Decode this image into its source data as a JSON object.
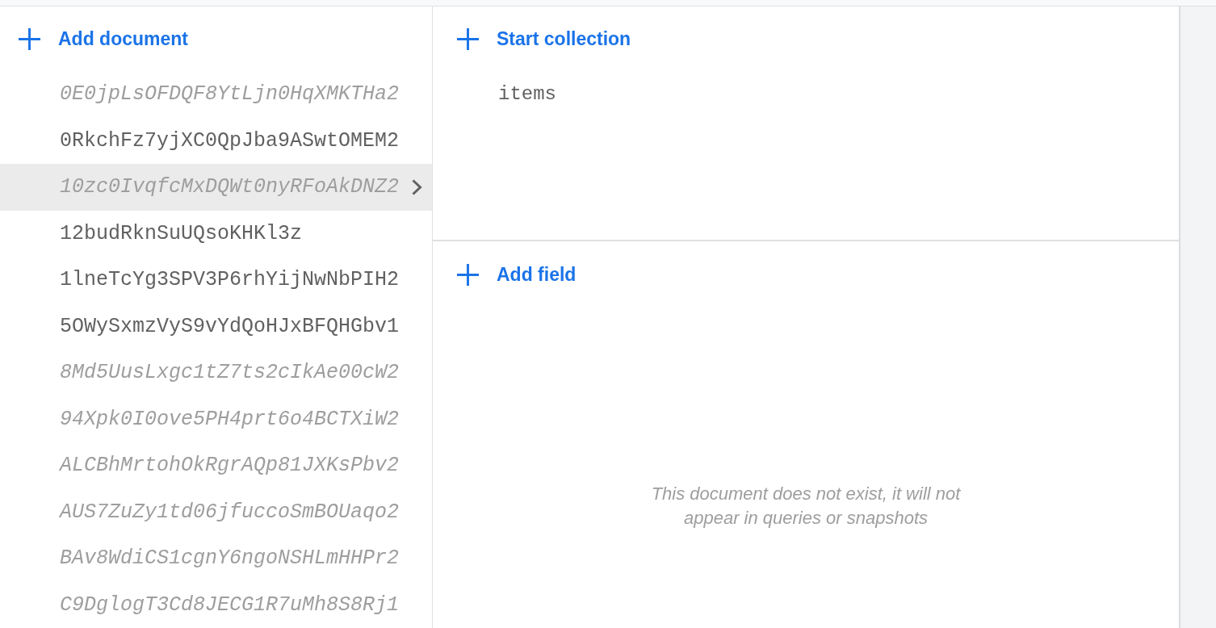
{
  "documents_panel": {
    "add_button": {
      "label": "Add document"
    },
    "documents": [
      {
        "id": "0E0jpLsOFDQF8YtLjn0HqXMKTHa2",
        "exists": false,
        "selected": false
      },
      {
        "id": "0RkchFz7yjXC0QpJba9ASwtOMEM2",
        "exists": true,
        "selected": false
      },
      {
        "id": "10zc0IvqfcMxDQWt0nyRFoAkDNZ2",
        "exists": false,
        "selected": true
      },
      {
        "id": "12budRknSuUQsoKHKl3z",
        "exists": true,
        "selected": false
      },
      {
        "id": "1lneTcYg3SPV3P6rhYijNwNbPIH2",
        "exists": true,
        "selected": false
      },
      {
        "id": "5OWySxmzVyS9vYdQoHJxBFQHGbv1",
        "exists": true,
        "selected": false
      },
      {
        "id": "8Md5UusLxgc1tZ7ts2cIkAe00cW2",
        "exists": false,
        "selected": false
      },
      {
        "id": "94Xpk0I0ove5PH4prt6o4BCTXiW2",
        "exists": false,
        "selected": false
      },
      {
        "id": "ALCBhMrtohOkRgrAQp81JXKsPbv2",
        "exists": false,
        "selected": false
      },
      {
        "id": "AUS7ZuZy1td06jfuccoSmBOUaqo2",
        "exists": false,
        "selected": false
      },
      {
        "id": "BAv8WdiCS1cgnY6ngoNSHLmHHPr2",
        "exists": false,
        "selected": false
      },
      {
        "id": "C9DglogT3Cd8JECG1R7uMh8S8Rj1",
        "exists": false,
        "selected": false
      }
    ]
  },
  "document_panel": {
    "start_collection_button": {
      "label": "Start collection"
    },
    "collections": [
      "items"
    ],
    "add_field_button": {
      "label": "Add field"
    },
    "empty_message": "This document does not exist, it will not appear in queries or snapshots"
  }
}
